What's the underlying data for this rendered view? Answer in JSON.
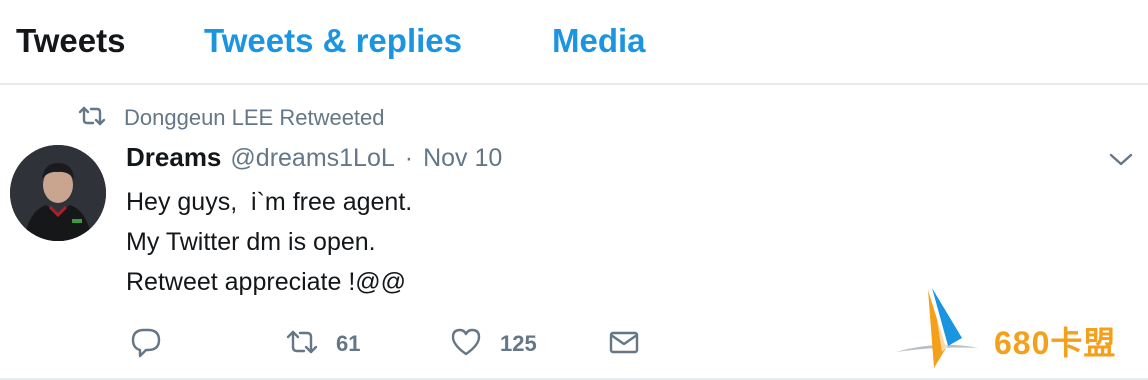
{
  "tabs": {
    "tweets": "Tweets",
    "replies": "Tweets & replies",
    "media": "Media"
  },
  "retweet_context": {
    "text": "Donggeun LEE Retweeted"
  },
  "tweet": {
    "name": "Dreams",
    "handle": "@dreams1LoL",
    "separator": "·",
    "date": "Nov 10",
    "lines": [
      "Hey guys,  i`m free agent.",
      "My Twitter dm is open.",
      "Retweet appreciate !@@"
    ],
    "retweets": "61",
    "likes": "125"
  },
  "watermark": {
    "text": "680卡盟"
  },
  "icons": {
    "retweet_context": "retweet-icon",
    "avatar": "avatar",
    "caret": "chevron-down-icon",
    "reply": "reply-icon",
    "retweet": "retweet-icon",
    "like": "heart-icon",
    "dm": "envelope-icon"
  },
  "colors": {
    "link": "#1b95e0",
    "text": "#14171a",
    "muted": "#657786",
    "watermark": "#f5a01a"
  }
}
